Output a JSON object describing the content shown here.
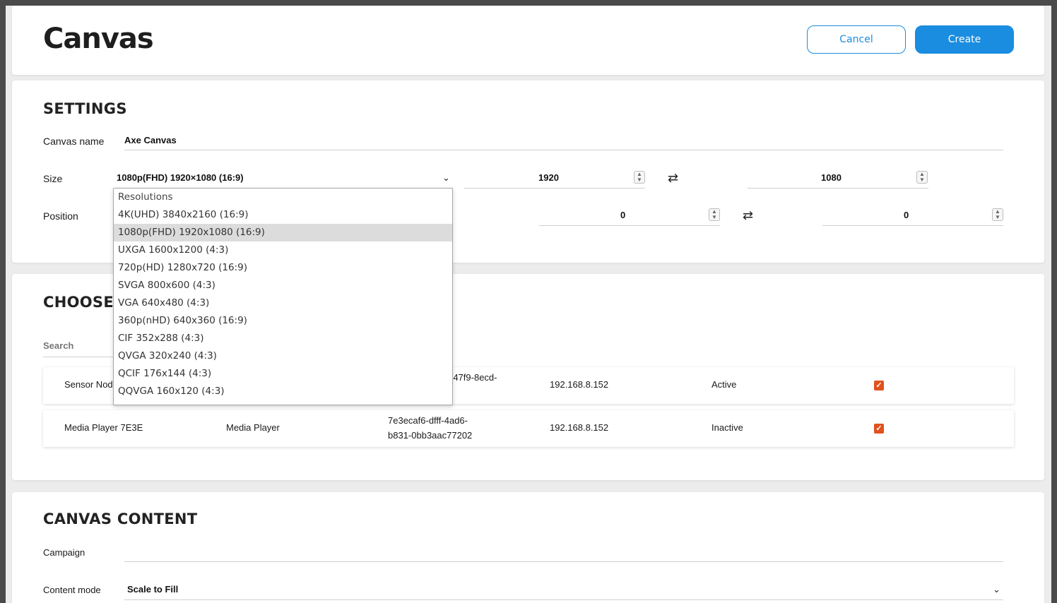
{
  "header": {
    "title": "Canvas",
    "cancel_label": "Cancel",
    "create_label": "Create"
  },
  "settings": {
    "title": "SETTINGS",
    "canvas_name_label": "Canvas name",
    "canvas_name_value": "Axe Canvas",
    "size_label": "Size",
    "size_selected": "1080p(FHD) 1920×1080 (16:9)",
    "width_value": "1920",
    "height_value": "1080",
    "position_label": "Position",
    "pos_x_value": "0",
    "pos_y_value": "0"
  },
  "resolution_dropdown": {
    "header": "Resolutions",
    "options": [
      "4K(UHD) 3840x2160 (16:9)",
      "1080p(FHD) 1920x1080 (16:9)",
      "UXGA 1600x1200 (4:3)",
      "720p(HD) 1280x720 (16:9)",
      "SVGA 800x600 (4:3)",
      "VGA 640x480 (4:3)",
      "360p(nHD) 640x360 (16:9)",
      "CIF 352x288 (4:3)",
      "QVGA 320x240 (4:3)",
      "QCIF 176x144 (4:3)",
      "QQVGA 160x120 (4:3)"
    ],
    "selected_index": 1
  },
  "choose": {
    "title": "CHOOSE",
    "search_label": "Search",
    "rows": [
      {
        "name": "Sensor Node",
        "type": "",
        "id_line1": "-47f9-8ecd-",
        "id_line2": "",
        "ip": "192.168.8.152",
        "status": "Active",
        "checked": true
      },
      {
        "name": "Media Player 7E3E",
        "type": "Media Player",
        "id_line1": "7e3ecaf6-dfff-4ad6-",
        "id_line2": "b831-0bb3aac77202",
        "ip": "192.168.8.152",
        "status": "Inactive",
        "checked": true
      }
    ]
  },
  "content": {
    "title": "CANVAS CONTENT",
    "campaign_label": "Campaign",
    "campaign_value": "",
    "content_mode_label": "Content mode",
    "content_mode_value": "Scale to Fill"
  },
  "colors": {
    "accent": "#1a8de0",
    "check": "#e0521e"
  },
  "icons": {
    "swap": "swap-arrows-icon",
    "chevron": "chevron-down-icon",
    "check": "checkmark-icon"
  }
}
